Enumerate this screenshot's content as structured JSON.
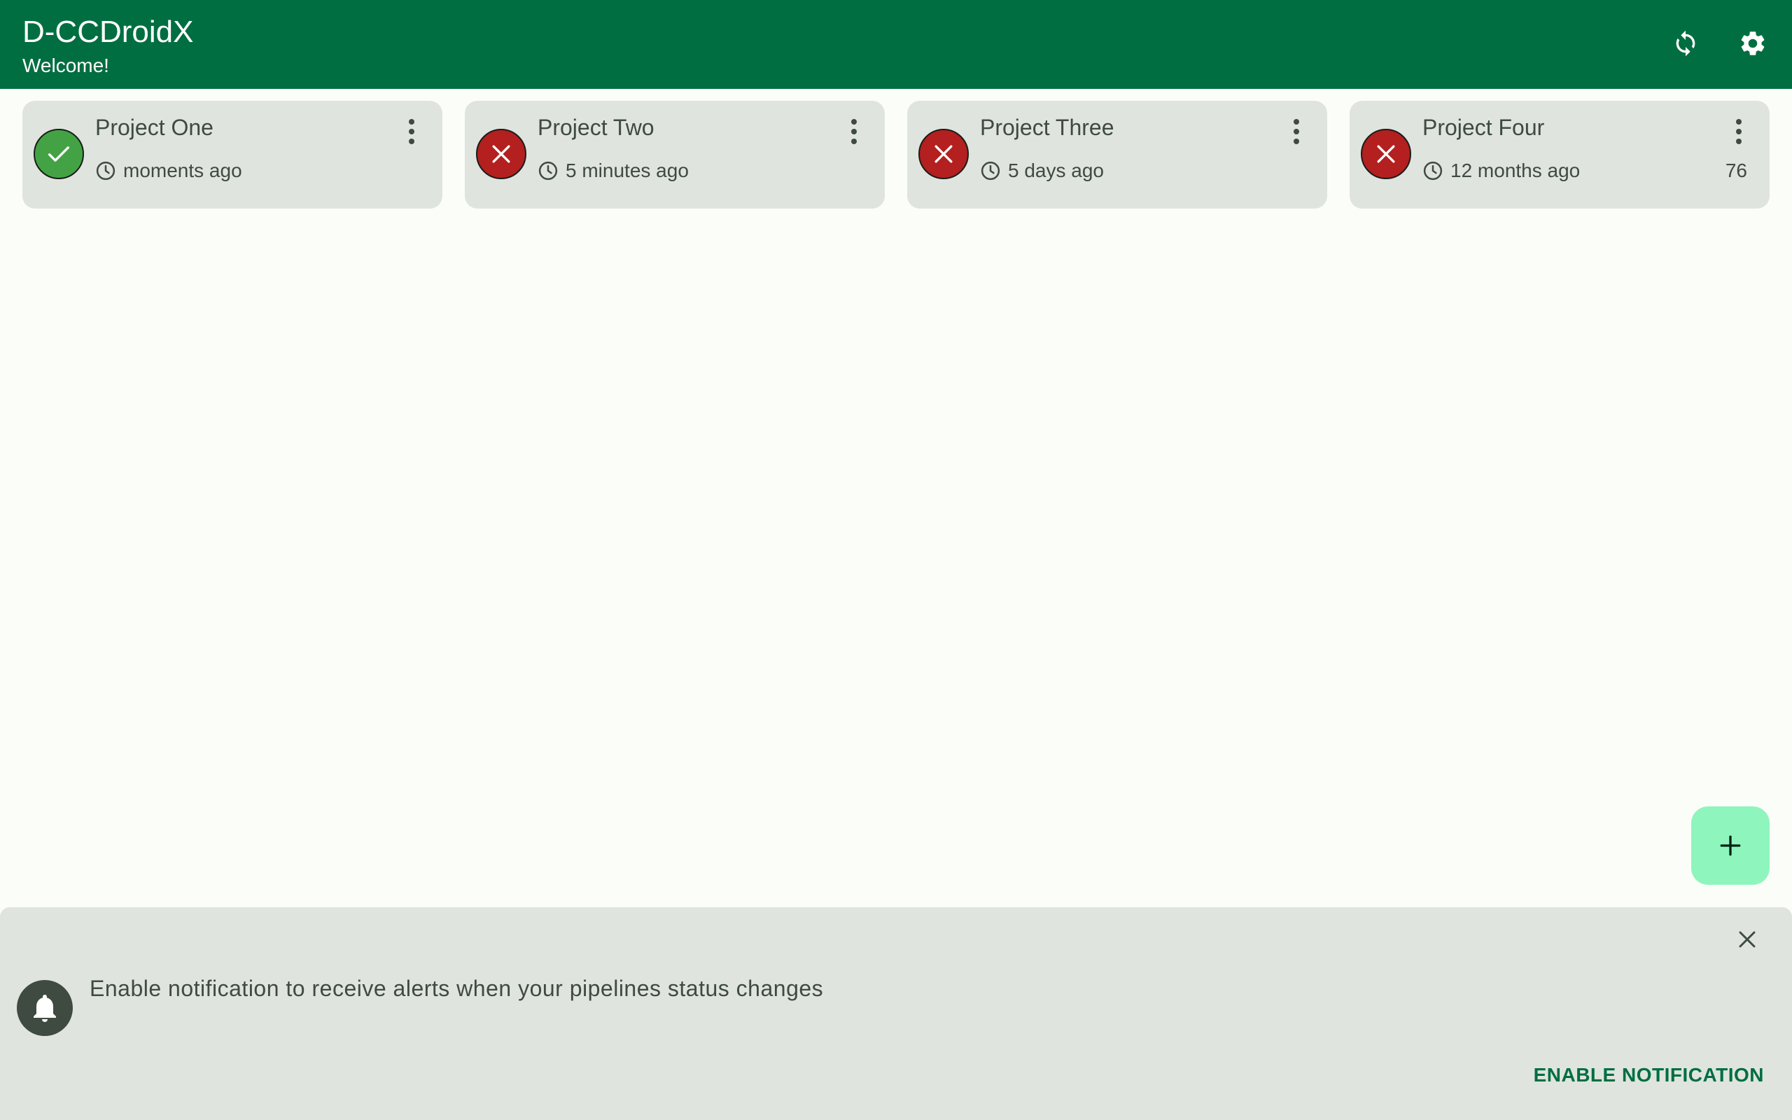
{
  "app": {
    "title": "D-CCDroidX",
    "subtitle": "Welcome!",
    "actions": [
      {
        "icon": "refresh-icon"
      },
      {
        "icon": "settings-icon"
      }
    ]
  },
  "colors": {
    "app_bar": "#006e41",
    "background": "#fbfdf8",
    "card": "#dfe5de",
    "success": "#43a344",
    "failed": "#b3201f",
    "fab": "#8ef5bd",
    "accent_text": "#006e41"
  },
  "projects": [
    {
      "name": "Project One",
      "status": "success",
      "time": "moments ago",
      "count": ""
    },
    {
      "name": "Project Two",
      "status": "failed",
      "time": "5 minutes ago",
      "count": ""
    },
    {
      "name": "Project Three",
      "status": "failed",
      "time": "5 days ago",
      "count": ""
    },
    {
      "name": "Project Four",
      "status": "failed",
      "time": "12 months ago",
      "count": "76"
    }
  ],
  "fab": {
    "icon": "plus-icon"
  },
  "banner": {
    "icon": "bell-icon",
    "message": "Enable notification to receive alerts when your pipelines status changes",
    "action_label": "ENABLE NOTIFICATION",
    "close_icon": "close-icon"
  }
}
